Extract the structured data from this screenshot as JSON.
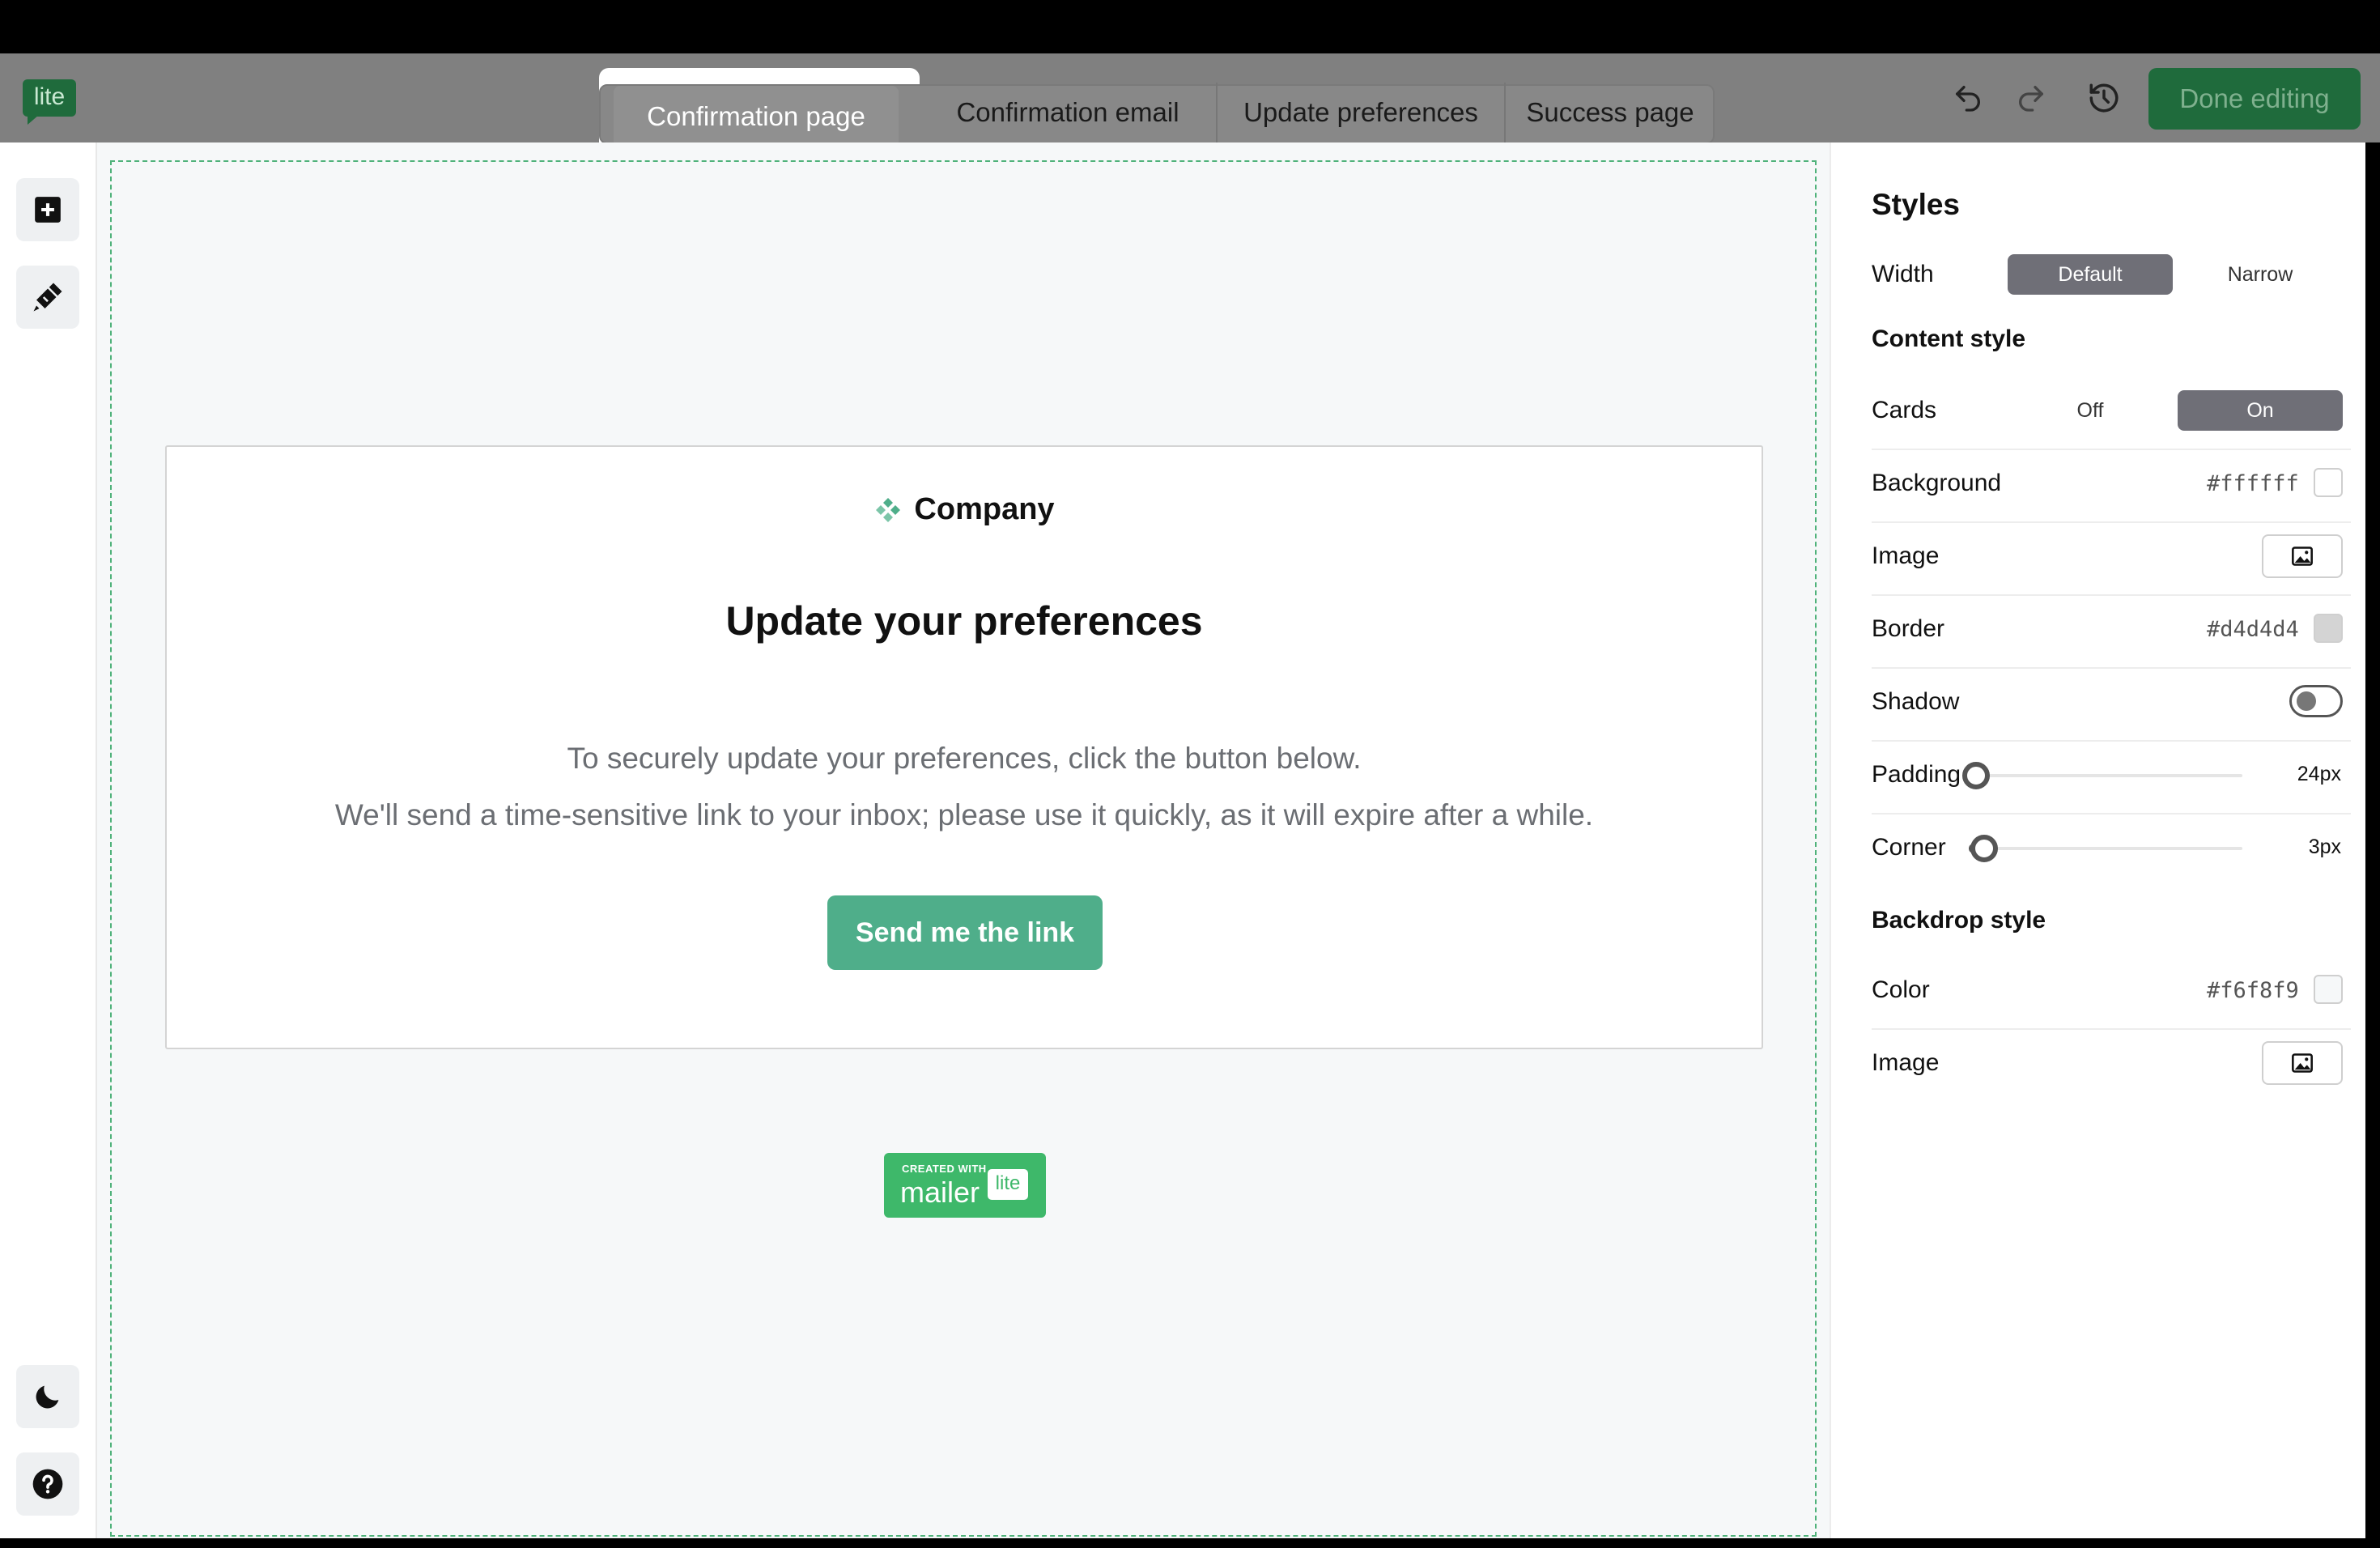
{
  "header": {
    "logo": "lite",
    "tabs": [
      {
        "label": "Confirmation page"
      },
      {
        "label": "Confirmation email"
      },
      {
        "label": "Update preferences"
      },
      {
        "label": "Success page"
      }
    ],
    "done_label": "Done editing"
  },
  "sidebar": {
    "icons": [
      "add-block-icon",
      "style-brush-icon",
      "moon-icon",
      "help-icon"
    ]
  },
  "card": {
    "company": "Company",
    "title": "Update your preferences",
    "line1": "To securely update your preferences, click the button below.",
    "line2": "We'll send a time-sensitive link to your inbox; please use it quickly, as it will expire after a while.",
    "button": "Send me the link"
  },
  "badge": {
    "created_with": "CREATED WITH",
    "brand": "mailer",
    "lite": "lite"
  },
  "styles": {
    "title": "Styles",
    "width": {
      "label": "Width",
      "options": [
        "Default",
        "Narrow"
      ],
      "selected": "Default"
    },
    "content_style": "Content style",
    "cards": {
      "label": "Cards",
      "options": [
        "Off",
        "On"
      ],
      "selected": "On"
    },
    "background": {
      "label": "Background",
      "value": "#ffffff"
    },
    "image": {
      "label": "Image"
    },
    "border": {
      "label": "Border",
      "value": "#d4d4d4"
    },
    "shadow": {
      "label": "Shadow",
      "on": false
    },
    "padding": {
      "label": "Padding",
      "value": "24px",
      "level": 0
    },
    "corner": {
      "label": "Corner",
      "value": "3px",
      "level": 0.03
    },
    "backdrop_style": "Backdrop style",
    "color": {
      "label": "Color",
      "value": "#f6f8f9"
    },
    "backdrop_image": {
      "label": "Image"
    }
  },
  "colors": {
    "accent": "#4fae8a",
    "brand_green": "#1f6b3c",
    "canvas_bg": "#f6f8f9"
  }
}
